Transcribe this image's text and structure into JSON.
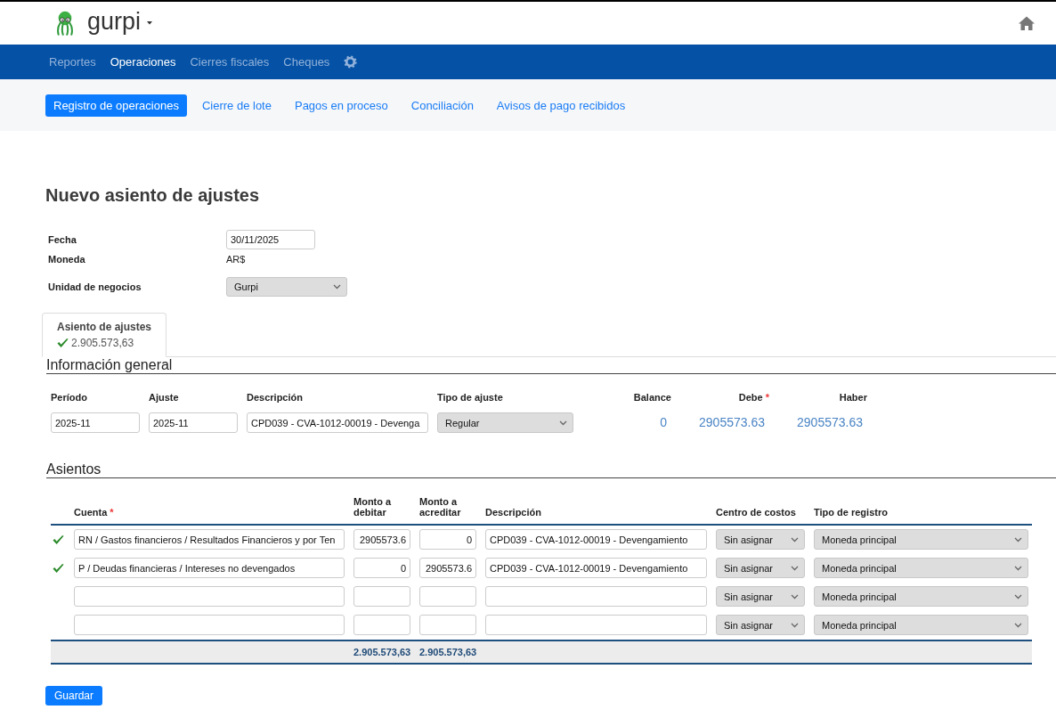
{
  "header": {
    "brand": "gurpi"
  },
  "nav": [
    {
      "label": "Reportes",
      "selected": false
    },
    {
      "label": "Operaciones",
      "selected": true
    },
    {
      "label": "Cierres fiscales",
      "selected": false
    },
    {
      "label": "Cheques",
      "selected": false
    }
  ],
  "subnav": [
    {
      "label": "Registro de operaciones",
      "selected": true
    },
    {
      "label": "Cierre de lote",
      "selected": false
    },
    {
      "label": "Pagos en proceso",
      "selected": false
    },
    {
      "label": "Conciliación",
      "selected": false
    },
    {
      "label": "Avisos de pago recibidos",
      "selected": false
    }
  ],
  "page_title": "Nuevo asiento de ajustes",
  "form": [
    {
      "label": "Fecha",
      "kind": "input",
      "value": "30/11/2025"
    },
    {
      "label": "Moneda",
      "kind": "text",
      "value": "AR$"
    },
    {
      "label": "Unidad de negocios",
      "kind": "select",
      "value": "Gurpi"
    }
  ],
  "entry_tabs": [
    {
      "title": "Asiento de ajustes",
      "amount": "2.905.573,63",
      "valid": true,
      "selected": true
    }
  ],
  "general": {
    "title": "Información general",
    "fields": [
      {
        "label": "Período",
        "kind": "input",
        "value": "2025-11"
      },
      {
        "label": "Ajuste",
        "kind": "input",
        "value": "2025-11"
      },
      {
        "label": "Descripción",
        "kind": "input",
        "value": "CPD039 - CVA-1012-00019 - Devenga"
      },
      {
        "label": "Tipo de ajuste",
        "kind": "select",
        "value": "Regular"
      }
    ],
    "totals": [
      {
        "label": "Balance",
        "value": "0"
      },
      {
        "label": "Debe",
        "required_mark": "*",
        "value": "2905573.63"
      },
      {
        "label": "Haber",
        "value": "2905573.63"
      }
    ]
  },
  "entries": {
    "title": "Asientos",
    "columns": [
      {
        "label": "Cuenta",
        "required_mark": "*"
      },
      {
        "label": "Monto a debitar"
      },
      {
        "label": "Monto a acreditar"
      },
      {
        "label": "Descripción"
      },
      {
        "label": "Centro de costos"
      },
      {
        "label": "Tipo de registro"
      }
    ],
    "rows": [
      {
        "valid": true,
        "account": "RN / Gastos financieros / Resultados Financieros y por Ten",
        "debit": "2905573.6",
        "credit": "0",
        "description": "CPD039 - CVA-1012-00019 - Devengamiento",
        "cost_center": "Sin asignar",
        "record_type": "Moneda principal"
      },
      {
        "valid": true,
        "account": "P / Deudas financieras / Intereses no devengados",
        "debit": "0",
        "credit": "2905573.6",
        "description": "CPD039 - CVA-1012-00019 - Devengamiento",
        "cost_center": "Sin asignar",
        "record_type": "Moneda principal"
      },
      {
        "valid": false,
        "cost_center": "Sin asignar",
        "record_type": "Moneda principal"
      },
      {
        "valid": false,
        "cost_center": "Sin asignar",
        "record_type": "Moneda principal"
      }
    ],
    "totals": {
      "debit": "2.905.573,63",
      "credit": "2.905.573,63"
    }
  },
  "save_button": "Guardar"
}
